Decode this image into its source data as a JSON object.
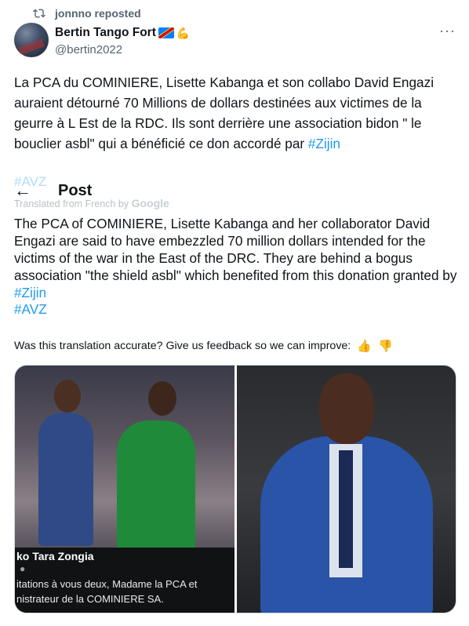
{
  "repost": {
    "text": "jonnno reposted",
    "icon": "repost-icon"
  },
  "author": {
    "name": "Bertin Tango Fort",
    "handle": "@bertin2022",
    "badges": [
      "drc-flag-icon",
      "flexed-biceps-icon"
    ]
  },
  "menu": {
    "label": "···"
  },
  "original": {
    "text": "La PCA du COMINIERE, Lisette Kabanga et son collabo David Engazi auraient  détourné 70 Millions de dollars destinées aux victimes de la geurre à L Est de la RDC.  Ils sont derrière  une association bidon \" le bouclier asbl\"  qui a bénéficié ce don accordé par ",
    "hashtag1": "#Zijin",
    "hashtag2": "#AVZ"
  },
  "header": {
    "back": "←",
    "title": "Post"
  },
  "translated_note": {
    "prefix": "Translated from French by ",
    "brand": "Google"
  },
  "translation": {
    "text": "The PCA of COMINIERE, Lisette Kabanga and her collaborator David Engazi are said to have embezzled 70 million dollars intended for the victims of the war in the East of the DRC. They are behind a bogus association \"the shield asbl\" which benefited from this donation granted by ",
    "hashtag1": "#Zijin",
    "hashtag2": "#AVZ"
  },
  "feedback": {
    "question": "Was this translation accurate? Give us feedback so we can improve:",
    "up": "👍",
    "down": "👎"
  },
  "media": {
    "image1": {
      "caption_name": "ko Tara Zongia",
      "caption_line1": "itations à vous deux, Madame la PCA et",
      "caption_line2": "nistrateur de la COMINIERE SA."
    }
  }
}
